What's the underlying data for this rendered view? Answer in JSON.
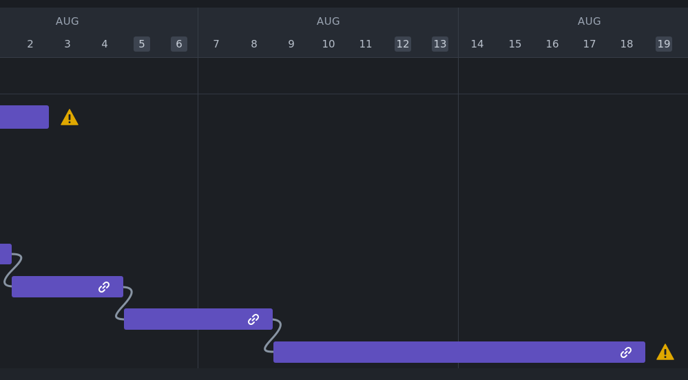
{
  "timeline": {
    "weeks": [
      {
        "label": "AUG"
      },
      {
        "label": "AUG"
      },
      {
        "label": "AUG"
      }
    ],
    "days": [
      {
        "label": "2",
        "weekend": false
      },
      {
        "label": "3",
        "weekend": false
      },
      {
        "label": "4",
        "weekend": false
      },
      {
        "label": "5",
        "weekend": true
      },
      {
        "label": "6",
        "weekend": true
      },
      {
        "label": "7",
        "weekend": false
      },
      {
        "label": "8",
        "weekend": false
      },
      {
        "label": "9",
        "weekend": false
      },
      {
        "label": "10",
        "weekend": false
      },
      {
        "label": "11",
        "weekend": false
      },
      {
        "label": "12",
        "weekend": true
      },
      {
        "label": "13",
        "weekend": true
      },
      {
        "label": "14",
        "weekend": false
      },
      {
        "label": "15",
        "weekend": false
      },
      {
        "label": "16",
        "weekend": false
      },
      {
        "label": "17",
        "weekend": false
      },
      {
        "label": "18",
        "weekend": false
      },
      {
        "label": "19",
        "weekend": true
      }
    ]
  },
  "tasks": [
    {
      "name": "task-bar-1",
      "start": "Jul 30",
      "end": "Aug 3",
      "linked": false,
      "warning": true
    },
    {
      "name": "task-bar-2",
      "start": "Jul 31",
      "end": "Aug 2",
      "linked": false,
      "warning": false
    },
    {
      "name": "task-bar-3",
      "start": "Aug 2",
      "end": "Aug 5",
      "linked": true,
      "warning": false
    },
    {
      "name": "task-bar-4",
      "start": "Aug 5",
      "end": "Aug 9",
      "linked": true,
      "warning": false
    },
    {
      "name": "task-bar-5",
      "start": "Aug 9",
      "end": "Aug 18",
      "linked": true,
      "warning": true
    }
  ],
  "colors": {
    "bar": "#5f4fbe",
    "warning": "#e0a800",
    "connector": "#8894a3",
    "weekend_highlight": "#3d4450"
  },
  "icons": {
    "warning": "warning-triangle-icon",
    "link": "link-icon"
  }
}
